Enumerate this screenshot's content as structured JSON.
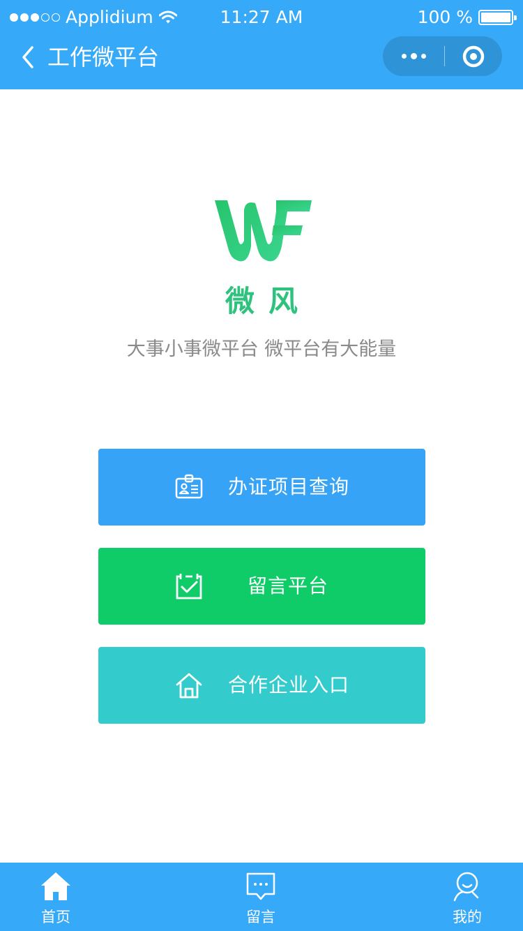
{
  "status_bar": {
    "carrier": "Applidium",
    "time": "11:27 AM",
    "battery": "100 %",
    "battery_level": 1.0
  },
  "nav": {
    "title": "工作微平台",
    "back_icon": "chevron-left-icon",
    "more_icon": "more-dots-icon",
    "close_icon": "target-circle-icon"
  },
  "brand": {
    "logo_icon": "wf-logo",
    "name": "微风",
    "slogan": "大事小事微平台 微平台有大能量",
    "color": "#2ec27e"
  },
  "actions": [
    {
      "label": "办证项目查询",
      "icon": "id-card-icon",
      "color": "#36a3f7"
    },
    {
      "label": "留言平台",
      "icon": "checklist-icon",
      "color": "#0fcc69"
    },
    {
      "label": "合作企业入口",
      "icon": "home-outline-icon",
      "color": "#33cbcb"
    }
  ],
  "tabbar": {
    "color": "#36a9f9",
    "items": [
      {
        "label": "首页",
        "icon": "home-filled-icon",
        "active": true
      },
      {
        "label": "留言",
        "icon": "message-icon",
        "active": false
      },
      {
        "label": "我的",
        "icon": "user-icon",
        "active": false
      }
    ]
  }
}
